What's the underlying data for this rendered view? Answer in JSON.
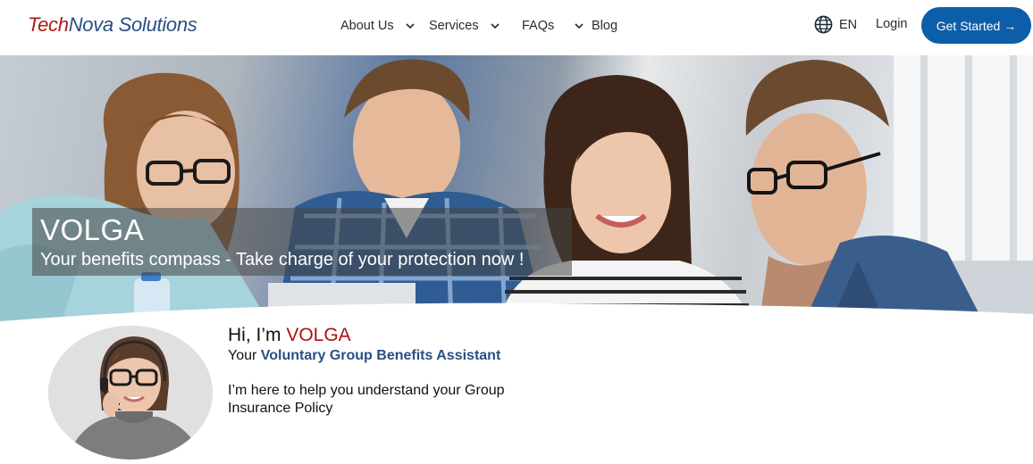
{
  "brand": {
    "logo_part1": "Tech",
    "logo_part2": "Nova Solutions",
    "color_red": "#b01818",
    "color_blue": "#2a4f86"
  },
  "nav": {
    "items": [
      {
        "label": "About Us",
        "has_dropdown": true
      },
      {
        "label": "Services",
        "has_dropdown": true
      },
      {
        "label": "FAQs",
        "has_dropdown": true
      },
      {
        "label": "Blog",
        "has_dropdown": false
      }
    ],
    "language": "EN",
    "language_icon": "globe-icon",
    "login": "Login",
    "cta": "Get Started →",
    "cta_color": "#0c5ea8"
  },
  "hero": {
    "title": "VOLGA",
    "subtitle": "Your benefits compass - Take charge of your protection now !"
  },
  "intro": {
    "greeting_prefix": "Hi, I’m ",
    "greeting_name": "VOLGA",
    "role_prefix": "Your ",
    "role_bold": "Voluntary Group Benefits Assistant",
    "description": "I’m here to help you understand your Group Insurance Policy"
  }
}
